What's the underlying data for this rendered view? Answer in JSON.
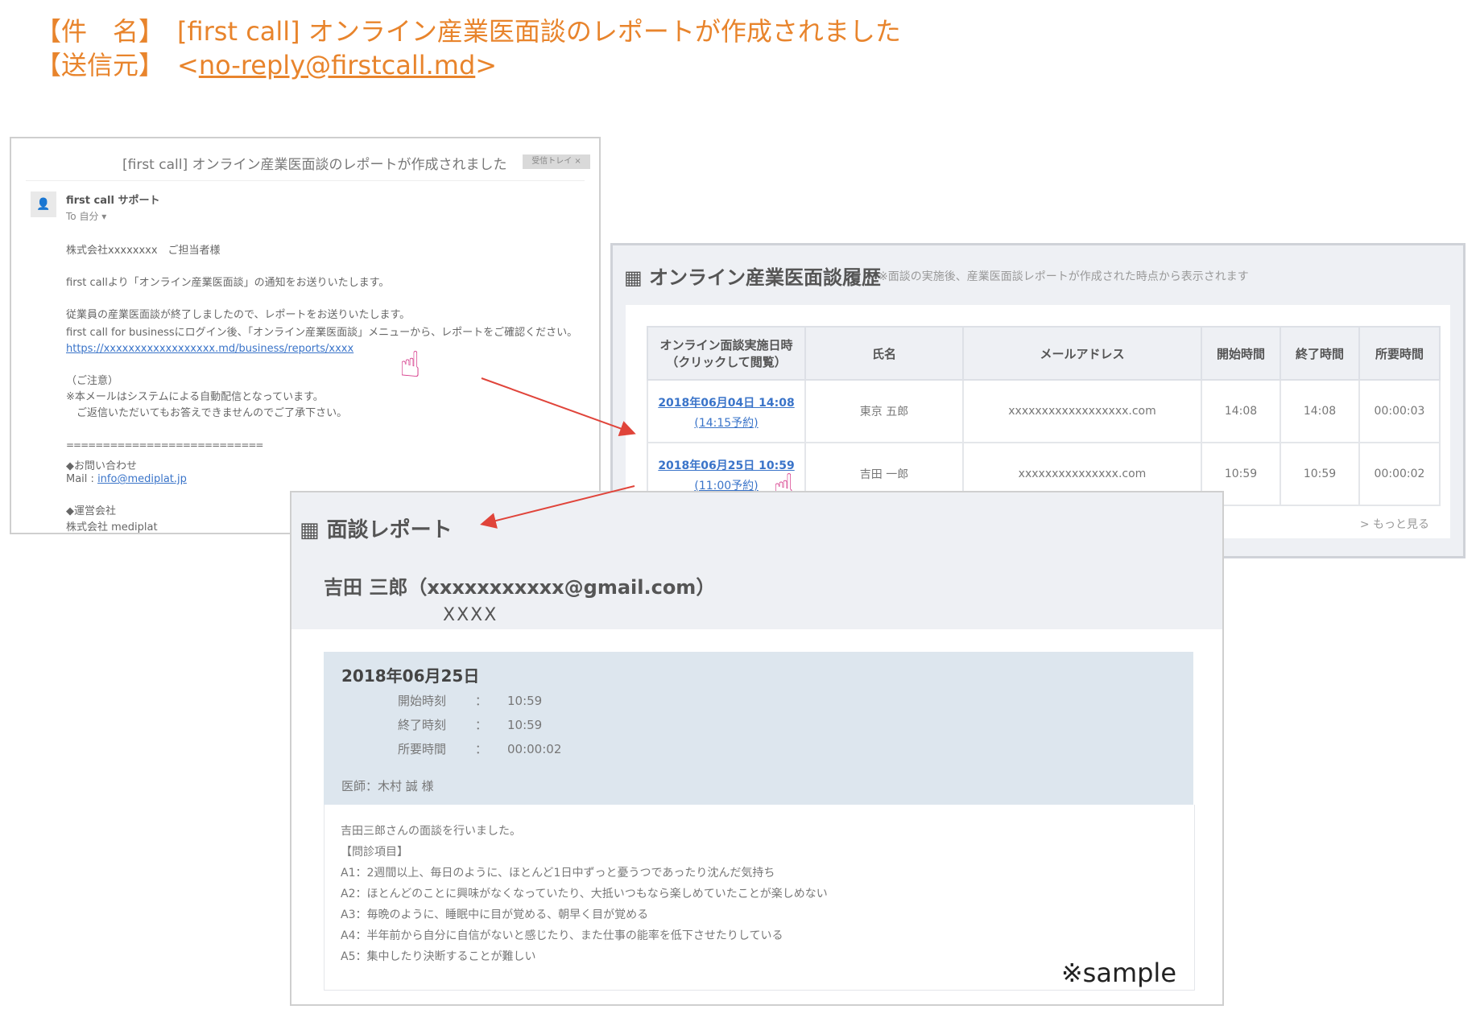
{
  "header": {
    "subject_label": "【件　名】",
    "subject_value": "[first call] オンライン産業医面談のレポートが作成されました",
    "from_label": "【送信元】",
    "from_prefix": "<",
    "from_value": "no-reply@firstcall.md",
    "from_suffix": ">"
  },
  "email": {
    "subject": "[first call] オンライン産業医面談のレポートが作成されました",
    "pill": "受信トレイ ×",
    "sender": "first call サポート",
    "to": "To 自分 ▾",
    "lines": [
      "株式会社xxxxxxxx　ご担当者様",
      "first callより「オンライン産業医面談」の通知をお送りいたします。",
      "従業員の産業医面談が終了しましたので、レポートをお送りいたします。",
      "first call for businessにログイン後、「オンライン産業医面談」メニューから、レポートをご確認ください。"
    ],
    "link_text": "https://xxxxxxxxxxxxxxxxxx.md/business/reports/xxxx",
    "notes": [
      "（ご注意）",
      "※本メールはシステムによる自動配信となっています。",
      "　ご返信いただいてもお答えできませんのでご了承下さい。"
    ],
    "divider": "===========================",
    "contact_title": "◆お問い合わせ",
    "contact_mail_prefix": "Mail : ",
    "contact_mail": "info@mediplat.jp",
    "company_title": "◆運営会社",
    "company_name": "株式会社 mediplat"
  },
  "history": {
    "title": "オンライン産業医面談履歴",
    "note": "※面談の実施後、産業医面談レポートが作成された時点から表示されます",
    "columns": [
      "オンライン面談実施日時（クリックして閲覧）",
      "氏名",
      "メールアドレス",
      "開始時間",
      "終了時間",
      "所要時間"
    ],
    "rows": [
      {
        "date_link": "2018年06月04日 14:08",
        "scheduled": "(14:15予約)",
        "name": "東京 五郎",
        "email": "xxxxxxxxxxxxxxxxxx.com",
        "start": "14:08",
        "end": "14:08",
        "duration": "00:00:03"
      },
      {
        "date_link": "2018年06月25日 10:59",
        "scheduled": "(11:00予約)",
        "name": "吉田 一郎",
        "email": "xxxxxxxxxxxxxxx.com",
        "start": "10:59",
        "end": "10:59",
        "duration": "00:00:02"
      }
    ],
    "more": "> もっと見る"
  },
  "report": {
    "title": "面談レポート",
    "person": "吉田 三郎（xxxxxxxxxxx@gmail.com）",
    "mask": "XXXX",
    "date": "2018年06月25日",
    "fields": [
      {
        "label": "開始時刻",
        "value": "10:59"
      },
      {
        "label": "終了時刻",
        "value": "10:59"
      },
      {
        "label": "所要時間",
        "value": "00:00:02"
      }
    ],
    "doctor": "医師：木村 誠 様",
    "body_lines": [
      "吉田三郎さんの面談を行いました。",
      "【問診項目】",
      "A1：2週間以上、毎日のように、ほとんど1日中ずっと憂うつであったり沈んだ気持ち",
      "A2：ほとんどのことに興味がなくなっていたり、大抵いつもなら楽しめていたことが楽しめない",
      "A3：毎晩のように、睡眠中に目が覚める、朝早く目が覚める",
      "A4：半年前から自分に自信がないと感じたり、また仕事の能率を低下させたりしている",
      "A5：集中したり決断することが難しい"
    ],
    "sample": "※sample"
  },
  "icons": {
    "calendar": "calendar-icon",
    "cursor": "hand-cursor-icon",
    "arrow": "red-arrow"
  }
}
